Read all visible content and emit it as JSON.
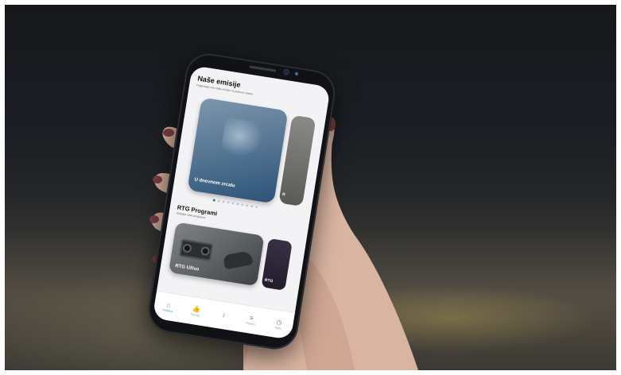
{
  "app": {
    "section_title": "Naše emisije",
    "section_subtitle": "Pogledajte sve naše emisije na jednom mjestu",
    "featured_card_title": "U dnevnom zrcalu",
    "featured_peek_text": "R",
    "carousel_dots": 10,
    "carousel_active_index": 0,
    "programs_title": "RTG Programi",
    "programs_subtitle": "Slušajte naše programe",
    "program_card_title": "RTG Uživo",
    "program_peek_text": "RTG"
  },
  "tabs": [
    {
      "label": "Početna",
      "icon": "home-icon",
      "glyph": "⌂",
      "active": true
    },
    {
      "label": "Popular",
      "icon": "thumbs-up-icon",
      "glyph": "👍",
      "active": false
    },
    {
      "label": "",
      "icon": "music-note-icon",
      "glyph": "♪",
      "active": false
    },
    {
      "label": "Playlist",
      "icon": "playlist-icon",
      "glyph": "≡",
      "active": false
    },
    {
      "label": "Nešto",
      "icon": "clock-icon",
      "glyph": "◷",
      "active": false
    }
  ],
  "colors": {
    "accent": "#2a8fc5",
    "dot_inactive": "#b7c8d8",
    "dot_active": "#2a6f9f"
  }
}
